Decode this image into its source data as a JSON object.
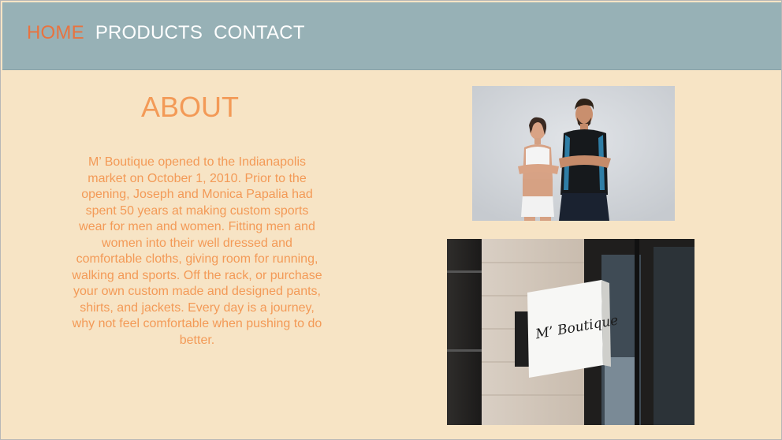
{
  "nav": {
    "items": [
      {
        "label": "HOME",
        "active": true
      },
      {
        "label": "PRODUCTS",
        "active": false
      },
      {
        "label": "CONTACT",
        "active": false
      }
    ]
  },
  "about": {
    "title": "ABOUT",
    "body": "M’ Boutique opened to the Indianapolis market on October 1, 2010. Prior to the opening, Joseph and Monica Papalia had spent 50 years at making custom sports wear for men and women. Fitting men and women into their well dressed and comfortable cloths, giving room for running, walking and sports. Off the rack, or purchase your own custom made and designed pants, shirts, and jackets. Every day is a journey, why not feel comfortable when pushing to do better."
  },
  "images": {
    "storefront_sign_text": "M’ Boutique"
  },
  "colors": {
    "nav_background": "#97b1b6",
    "nav_active": "#e8733f",
    "nav_text": "#ffffff",
    "page_background": "#f7e4c5",
    "about_text": "#f39a57"
  }
}
